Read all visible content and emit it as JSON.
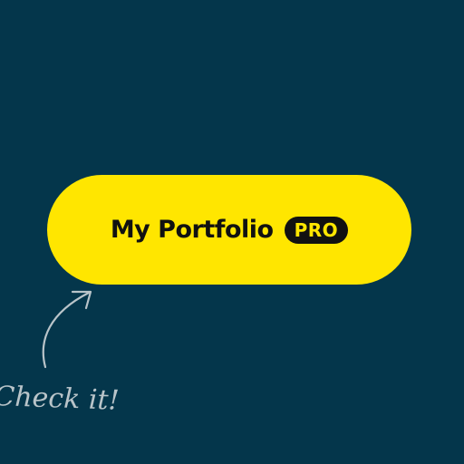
{
  "button": {
    "label": "My Portfolio",
    "badge": "PRO"
  },
  "annotation": {
    "text": "Check it!",
    "icon": "hand-drawn-arrow-icon"
  },
  "colors": {
    "background": "#04364b",
    "button_fill": "#ffe600",
    "button_text": "#111111",
    "badge_fill": "#111111",
    "badge_text": "#ffe600",
    "annotation": "#b9c4c9"
  }
}
